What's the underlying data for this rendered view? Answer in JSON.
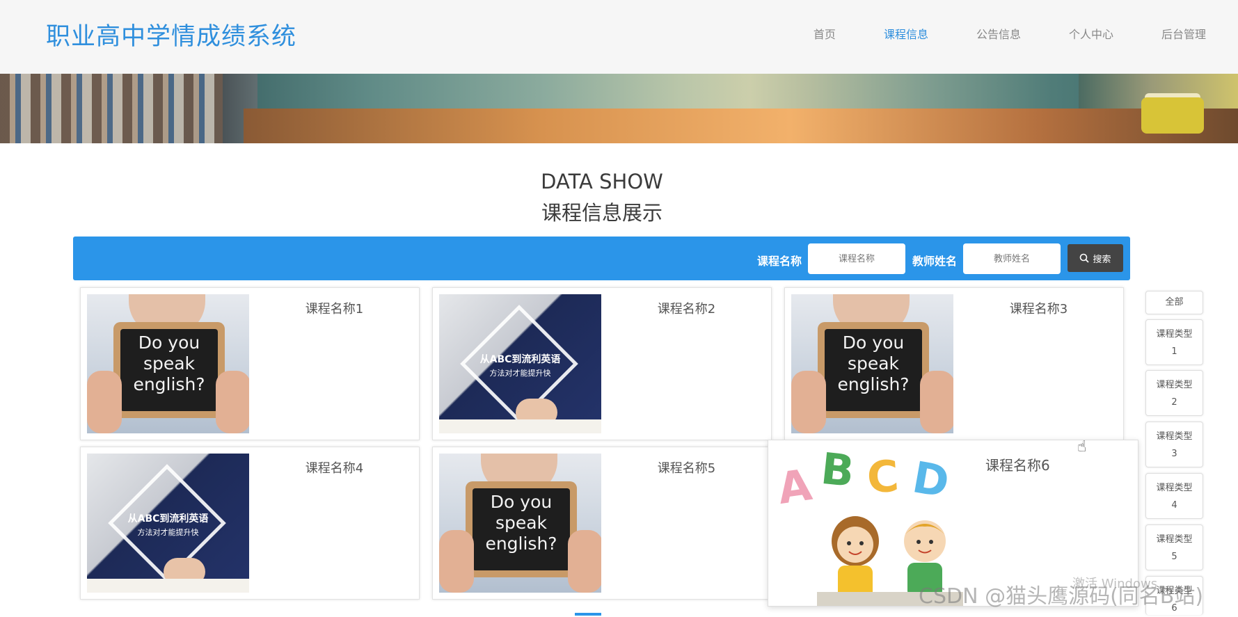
{
  "header": {
    "logo": "职业高中学情成绩系统",
    "nav": [
      {
        "label": "首页",
        "active": false
      },
      {
        "label": "课程信息",
        "active": true
      },
      {
        "label": "公告信息",
        "active": false
      },
      {
        "label": "个人中心",
        "active": false
      },
      {
        "label": "后台管理",
        "active": false
      }
    ]
  },
  "section": {
    "title_en": "DATA SHOW",
    "title_zh": "课程信息展示"
  },
  "search": {
    "course_label": "课程名称",
    "course_placeholder": "课程名称",
    "teacher_label": "教师姓名",
    "teacher_placeholder": "教师姓名",
    "button_label": "搜索"
  },
  "cards": [
    {
      "name": "课程名称1",
      "image": "slate",
      "slate_text": "Do you speak english?"
    },
    {
      "name": "课程名称2",
      "image": "abc",
      "overlay_line1": "从ABC到流利英语",
      "overlay_line2": "方法对才能提升快"
    },
    {
      "name": "课程名称3",
      "image": "slate",
      "slate_text": "Do you speak english?"
    },
    {
      "name": "课程名称4",
      "image": "abc",
      "overlay_line1": "从ABC到流利英语",
      "overlay_line2": "方法对才能提升快"
    },
    {
      "name": "课程名称5",
      "image": "slate",
      "slate_text": "Do you speak english?"
    },
    {
      "name": "课程名称6",
      "image": "abcd-kids",
      "letters": [
        "A",
        "B",
        "C",
        "D"
      ]
    }
  ],
  "sidebar": {
    "all_label": "全部",
    "types": [
      {
        "label": "课程类型",
        "num": "1"
      },
      {
        "label": "课程类型",
        "num": "2"
      },
      {
        "label": "课程类型",
        "num": "3"
      },
      {
        "label": "课程类型",
        "num": "4"
      },
      {
        "label": "课程类型",
        "num": "5"
      },
      {
        "label": "课程类型",
        "num": "6"
      }
    ]
  },
  "overlay": {
    "watermark": "CSDN @猫头鹰源码(同名B站)",
    "windows_activate": "激活 Windows"
  },
  "colors": {
    "accent": "#2b95e9",
    "logo": "#2f8fdd",
    "search_button": "#444444"
  }
}
